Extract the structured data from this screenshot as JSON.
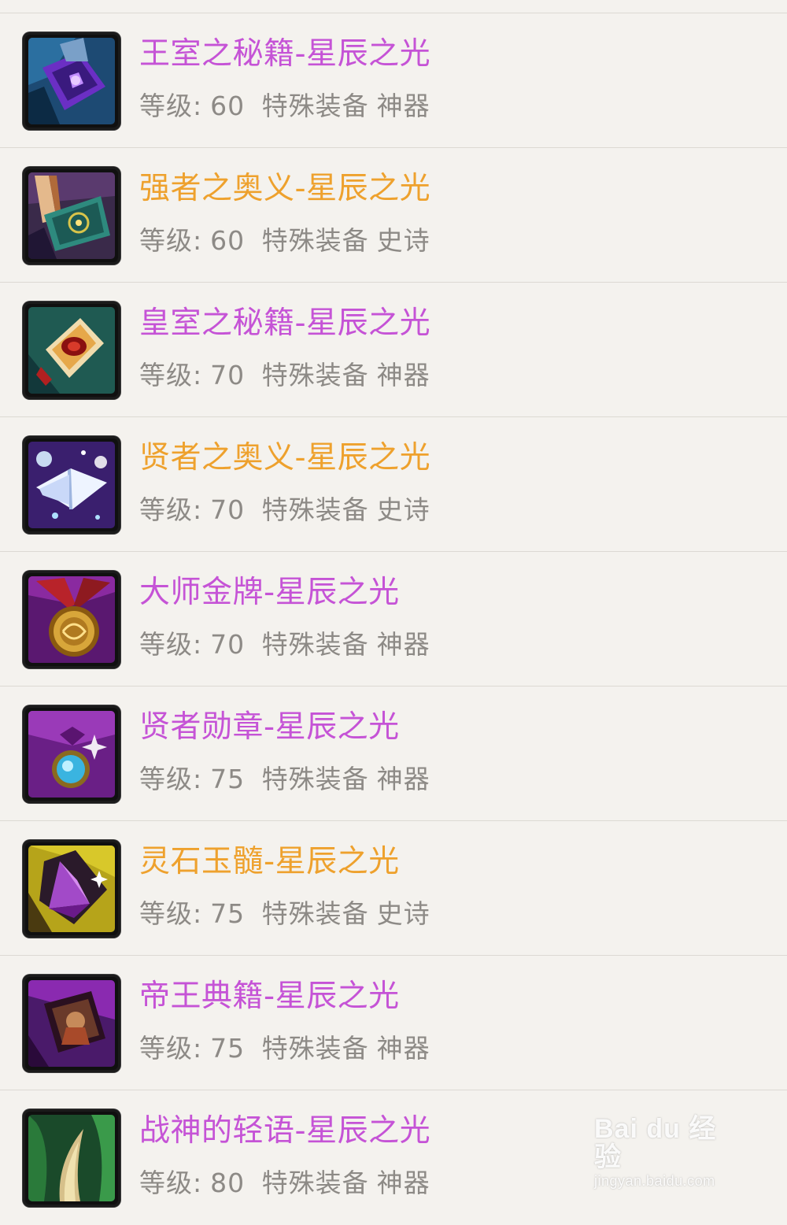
{
  "items": [
    {
      "name": "王室之秘籍-星辰之光",
      "level_label": "等级:",
      "level": "60",
      "type": "特殊装备",
      "rarity": "神器",
      "name_color": "#c553d6",
      "icon": "purple-rune-book-icon"
    },
    {
      "name": "强者之奥义-星辰之光",
      "level_label": "等级:",
      "level": "60",
      "type": "特殊装备",
      "rarity": "史诗",
      "name_color": "#eea12d",
      "icon": "green-spellbook-icon"
    },
    {
      "name": "皇室之秘籍-星辰之光",
      "level_label": "等级:",
      "level": "70",
      "type": "特殊装备",
      "rarity": "神器",
      "name_color": "#c553d6",
      "icon": "red-gem-book-icon"
    },
    {
      "name": "贤者之奥义-星辰之光",
      "level_label": "等级:",
      "level": "70",
      "type": "特殊装备",
      "rarity": "史诗",
      "name_color": "#eea12d",
      "icon": "glowing-book-icon"
    },
    {
      "name": "大师金牌-星辰之光",
      "level_label": "等级:",
      "level": "70",
      "type": "特殊装备",
      "rarity": "神器",
      "name_color": "#c553d6",
      "icon": "gold-medal-icon"
    },
    {
      "name": "贤者勋章-星辰之光",
      "level_label": "等级:",
      "level": "75",
      "type": "特殊装备",
      "rarity": "神器",
      "name_color": "#c553d6",
      "icon": "blue-gem-medal-icon"
    },
    {
      "name": "灵石玉髓-星辰之光",
      "level_label": "等级:",
      "level": "75",
      "type": "特殊装备",
      "rarity": "史诗",
      "name_color": "#eea12d",
      "icon": "purple-crystal-icon"
    },
    {
      "name": "帝王典籍-星辰之光",
      "level_label": "等级:",
      "level": "75",
      "type": "特殊装备",
      "rarity": "神器",
      "name_color": "#c553d6",
      "icon": "emperor-scroll-icon"
    },
    {
      "name": "战神的轻语-星辰之光",
      "level_label": "等级:",
      "level": "80",
      "type": "特殊装备",
      "rarity": "神器",
      "name_color": "#c553d6",
      "icon": "green-fang-icon"
    }
  ],
  "watermark": {
    "main": "Bai du 经验",
    "sub": "jingyan.baidu.com"
  }
}
